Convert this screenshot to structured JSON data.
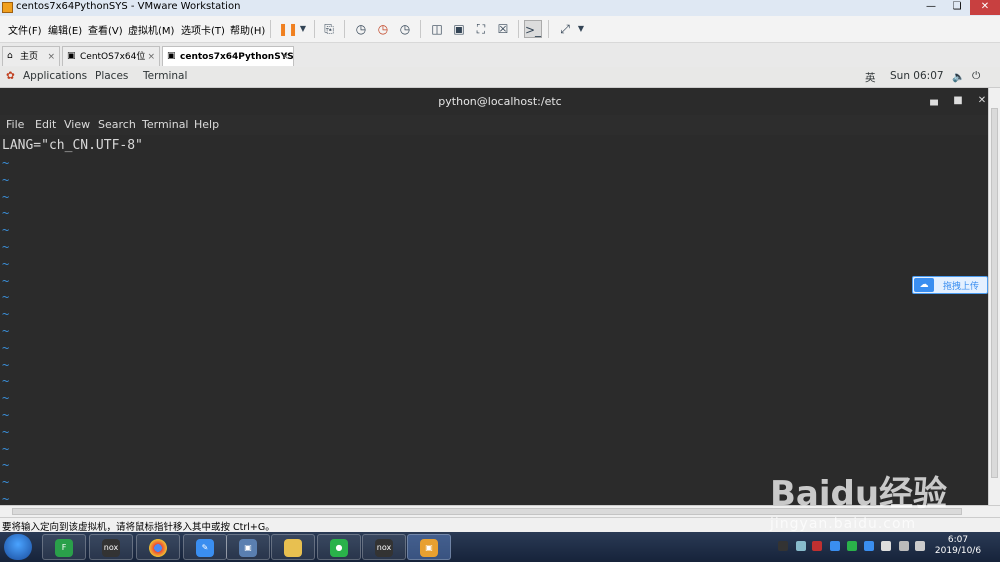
{
  "vm_window": {
    "title": "centos7x64PythonSYS - VMware Workstation"
  },
  "vm_menu": [
    "文件(F)",
    "编辑(E)",
    "查看(V)",
    "虚拟机(M)",
    "选项卡(T)",
    "帮助(H)"
  ],
  "vm_tabs": [
    {
      "label": "主页",
      "icon": "home-icon"
    },
    {
      "label": "CentOS7x64位",
      "icon": "vm-icon"
    },
    {
      "label": "centos7x64PythonSYS",
      "icon": "vm-icon",
      "active": true
    }
  ],
  "gnome_bar": {
    "applications": "Applications",
    "places": "Places",
    "terminal": "Terminal",
    "input_method": "英",
    "clock": "Sun 06:07"
  },
  "terminal": {
    "title": "python@localhost:/etc",
    "menu": [
      "File",
      "Edit",
      "View",
      "Search",
      "Terminal",
      "Help"
    ],
    "content_line": "LANG=\"ch_CN.UTF-8\"",
    "tilde": "~"
  },
  "upload_widget": {
    "label": "拖拽上传"
  },
  "vm_status": {
    "text": "要将输入定向到该虚拟机，请将鼠标指针移入其中或按 Ctrl+G。"
  },
  "taskbar": {
    "time": "6:07",
    "date": "2019/10/6"
  },
  "watermark": {
    "brand": "Bai⁠du经验",
    "url": "jingyan.baidu.com"
  },
  "colors": {
    "accent": "#3a8ef0",
    "terminal_bg": "#2b2b2b",
    "tilde": "#3a8ed8"
  }
}
